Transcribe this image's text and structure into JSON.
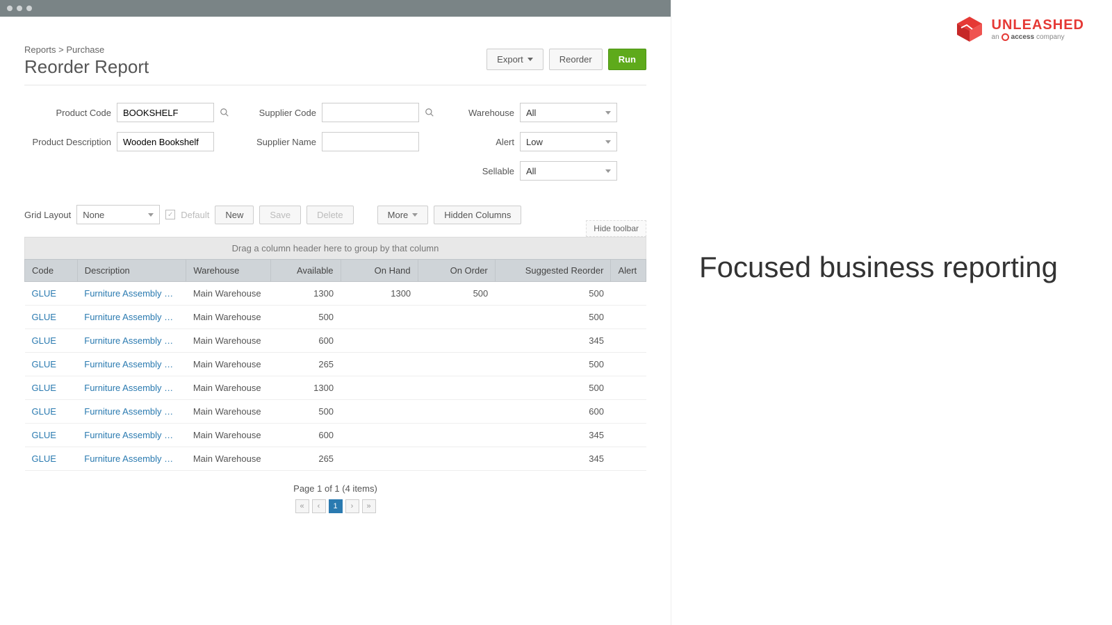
{
  "breadcrumb": "Reports > Purchase",
  "title": "Reorder Report",
  "header": {
    "export": "Export",
    "reorder": "Reorder",
    "run": "Run"
  },
  "filters": {
    "productCode": {
      "label": "Product Code",
      "value": "BOOKSHELF"
    },
    "productDescription": {
      "label": "Product Description",
      "value": "Wooden Bookshelf"
    },
    "supplierCode": {
      "label": "Supplier Code",
      "value": ""
    },
    "supplierName": {
      "label": "Supplier Name",
      "value": ""
    },
    "warehouse": {
      "label": "Warehouse",
      "value": "All"
    },
    "alert": {
      "label": "Alert",
      "value": "Low"
    },
    "sellable": {
      "label": "Sellable",
      "value": "All"
    }
  },
  "toolbar": {
    "gridLayoutLabel": "Grid Layout",
    "gridLayoutValue": "None",
    "default": "Default",
    "new": "New",
    "save": "Save",
    "delete": "Delete",
    "more": "More",
    "hiddenColumns": "Hidden Columns",
    "hideToolbar": "Hide toolbar"
  },
  "groupBar": "Drag a column header here to group by that column",
  "columns": {
    "code": "Code",
    "description": "Description",
    "warehouse": "Warehouse",
    "available": "Available",
    "onHand": "On Hand",
    "onOrder": "On Order",
    "suggestedReorder": "Suggested Reorder",
    "alert": "Alert"
  },
  "rows": [
    {
      "code": "GLUE",
      "description": "Furniture Assembly Glue",
      "warehouse": "Main Warehouse",
      "available": "1300",
      "onHand": "1300",
      "onOrder": "500",
      "suggestedReorder": "500",
      "alert": ""
    },
    {
      "code": "GLUE",
      "description": "Furniture Assembly Glue",
      "warehouse": "Main Warehouse",
      "available": "500",
      "onHand": "",
      "onOrder": "",
      "suggestedReorder": "500",
      "alert": ""
    },
    {
      "code": "GLUE",
      "description": "Furniture Assembly Glue",
      "warehouse": "Main Warehouse",
      "available": "600",
      "onHand": "",
      "onOrder": "",
      "suggestedReorder": "345",
      "alert": ""
    },
    {
      "code": "GLUE",
      "description": "Furniture Assembly Glue",
      "warehouse": "Main Warehouse",
      "available": "265",
      "onHand": "",
      "onOrder": "",
      "suggestedReorder": "500",
      "alert": ""
    },
    {
      "code": "GLUE",
      "description": "Furniture Assembly Glue",
      "warehouse": "Main Warehouse",
      "available": "1300",
      "onHand": "",
      "onOrder": "",
      "suggestedReorder": "500",
      "alert": ""
    },
    {
      "code": "GLUE",
      "description": "Furniture Assembly Glue",
      "warehouse": "Main Warehouse",
      "available": "500",
      "onHand": "",
      "onOrder": "",
      "suggestedReorder": "600",
      "alert": ""
    },
    {
      "code": "GLUE",
      "description": "Furniture Assembly Glue",
      "warehouse": "Main Warehouse",
      "available": "600",
      "onHand": "",
      "onOrder": "",
      "suggestedReorder": "345",
      "alert": ""
    },
    {
      "code": "GLUE",
      "description": "Furniture Assembly Glue",
      "warehouse": "Main Warehouse",
      "available": "265",
      "onHand": "",
      "onOrder": "",
      "suggestedReorder": "345",
      "alert": ""
    }
  ],
  "pagination": {
    "text": "Page 1 of 1 (4 items)",
    "first": "«",
    "prev": "‹",
    "current": "1",
    "next": "›",
    "last": "»"
  },
  "branding": {
    "name": "UNLEASHED",
    "subPrefix": "an",
    "subBrand": "access",
    "subSuffix": "company"
  },
  "headline": "Focused business reporting"
}
